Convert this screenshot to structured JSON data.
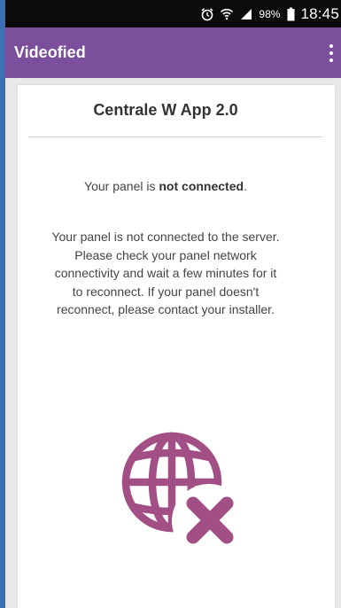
{
  "status_bar": {
    "battery": "98%",
    "time": "18:45",
    "icons": [
      "alarm-icon",
      "wifi-icon",
      "signal-icon",
      "battery-icon"
    ]
  },
  "app_bar": {
    "title": "Videofied",
    "menu_icon": "overflow-menu-icon"
  },
  "card": {
    "title": "Centrale W App 2.0",
    "status_prefix": "Your panel is ",
    "status_bold": "not connected",
    "status_suffix": ".",
    "message": "Your panel is not connected to the server. Please check your panel network connectivity and wait a few minutes for it to reconnect. If your panel doesn't reconnect, please contact your installer.",
    "illustration_icon": "globe-disconnected-icon"
  },
  "colors": {
    "app_bar": "#7b4f9c",
    "icon": "#a14f85",
    "background": "#e9e9e9"
  }
}
